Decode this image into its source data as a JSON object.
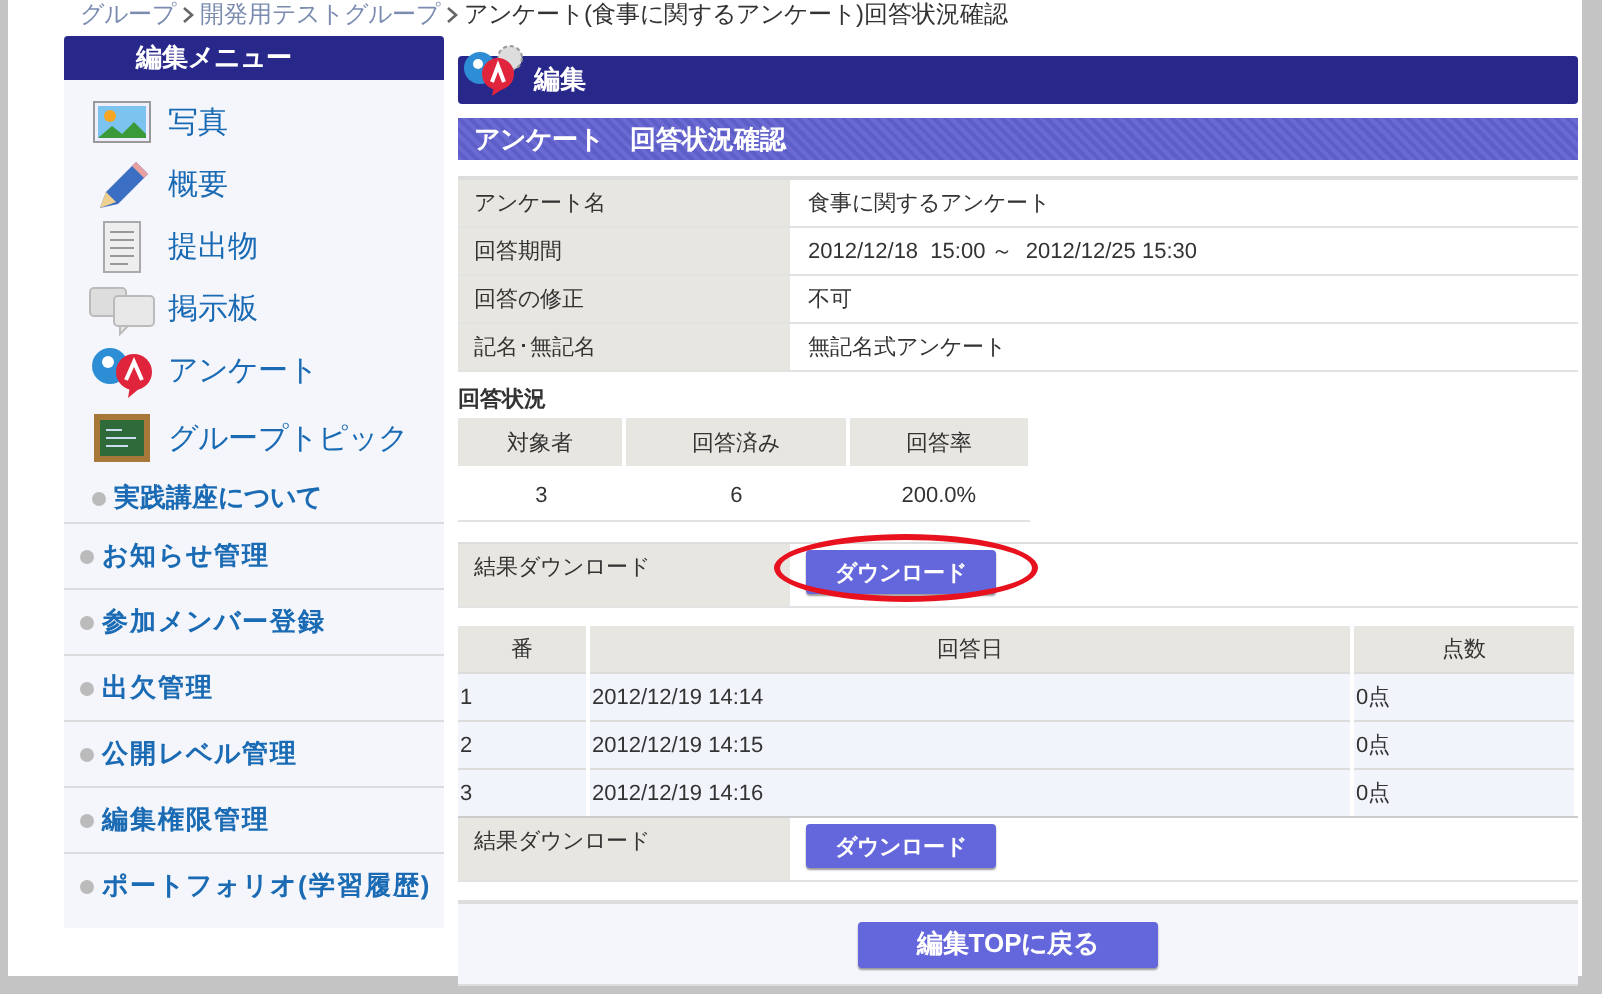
{
  "breadcrumb": [
    {
      "label": "グループ",
      "link": true
    },
    {
      "label": "開発用テストグループ",
      "link": true
    },
    {
      "label": "アンケート(食事に関するアンケート)回答状況確認",
      "link": false
    }
  ],
  "sidebar": {
    "title": "編集メニュー",
    "items": [
      {
        "label": "写真",
        "kind": "icon"
      },
      {
        "label": "概要",
        "kind": "icon"
      },
      {
        "label": "提出物",
        "kind": "icon"
      },
      {
        "label": "掲示板",
        "kind": "icon"
      },
      {
        "label": "アンケート",
        "kind": "icon"
      },
      {
        "label": "グループトピック",
        "kind": "icon"
      },
      {
        "label": "実践講座について",
        "kind": "sub"
      },
      {
        "label": "お知らせ管理",
        "kind": "section"
      },
      {
        "label": "参加メンバー登録",
        "kind": "section"
      },
      {
        "label": "出欠管理",
        "kind": "section"
      },
      {
        "label": "公開レベル管理",
        "kind": "section"
      },
      {
        "label": "編集権限管理",
        "kind": "section"
      },
      {
        "label": "ポートフォリオ(学習履歴)",
        "kind": "section"
      }
    ]
  },
  "header": {
    "title": "編集"
  },
  "section_title": "アンケート　回答状況確認",
  "info": [
    {
      "label": "アンケート名",
      "value": "食事に関するアンケート"
    },
    {
      "label": "回答期間",
      "value": "2012/12/18  15:00 ～  2012/12/25 15:30"
    },
    {
      "label": "回答の修正",
      "value": "不可"
    },
    {
      "label": "記名･無記名",
      "value": "無記名式アンケート"
    }
  ],
  "status": {
    "title": "回答状況",
    "columns": [
      "対象者",
      "回答済み",
      "回答率"
    ],
    "values": [
      "3",
      "6",
      "200.0%"
    ]
  },
  "download_top": {
    "label": "結果ダウンロード",
    "button": "ダウンロード",
    "highlighted": true
  },
  "responses": {
    "columns": [
      "番",
      "回答日",
      "点数"
    ],
    "rows": [
      [
        "1",
        "2012/12/19 14:14",
        "0点"
      ],
      [
        "2",
        "2012/12/19 14:15",
        "0点"
      ],
      [
        "3",
        "2012/12/19 14:16",
        "0点"
      ]
    ]
  },
  "download_bottom": {
    "label": "結果ダウンロード",
    "button": "ダウンロード",
    "highlighted": false
  },
  "back_button": "編集TOPに戻る"
}
